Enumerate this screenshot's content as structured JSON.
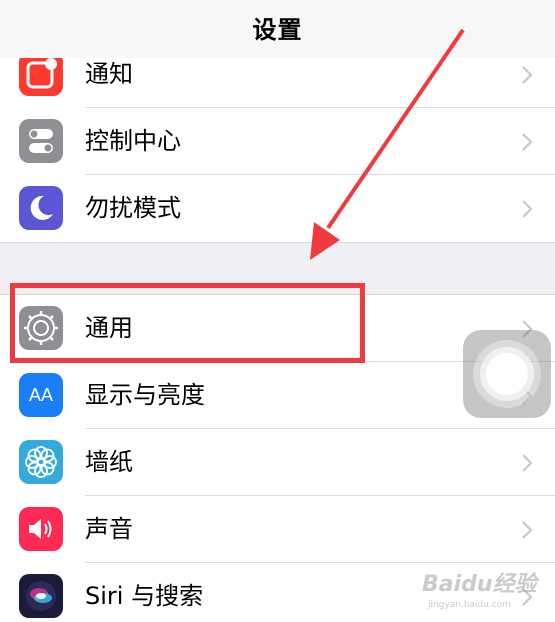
{
  "nav": {
    "title": "设置"
  },
  "groups": [
    {
      "items": [
        {
          "label": "通知",
          "icon": "notifications-icon",
          "color": "#fb3a30"
        },
        {
          "label": "控制中心",
          "icon": "control-center-icon",
          "color": "#8e8e93"
        },
        {
          "label": "勿扰模式",
          "icon": "do-not-disturb-moon-icon",
          "color": "#5a56d6"
        }
      ]
    },
    {
      "items": [
        {
          "label": "通用",
          "icon": "gear-icon",
          "color": "#8e8e93",
          "highlighted": true
        },
        {
          "label": "显示与亮度",
          "icon": "display-aa-icon",
          "color": "#1a7ef6"
        },
        {
          "label": "墙纸",
          "icon": "wallpaper-flower-icon",
          "color": "#34aadc"
        },
        {
          "label": "声音",
          "icon": "speaker-icon",
          "color": "#fb2b54"
        },
        {
          "label": "Siri 与搜索",
          "icon": "siri-icon",
          "color": "#1c1c3a"
        }
      ]
    }
  ],
  "icons": {
    "display_aa": "AA"
  },
  "annotation": {
    "color": "#ef3b3f"
  },
  "watermark": {
    "brand": "Baidu经验",
    "site": "jingyan.baidu.com"
  }
}
